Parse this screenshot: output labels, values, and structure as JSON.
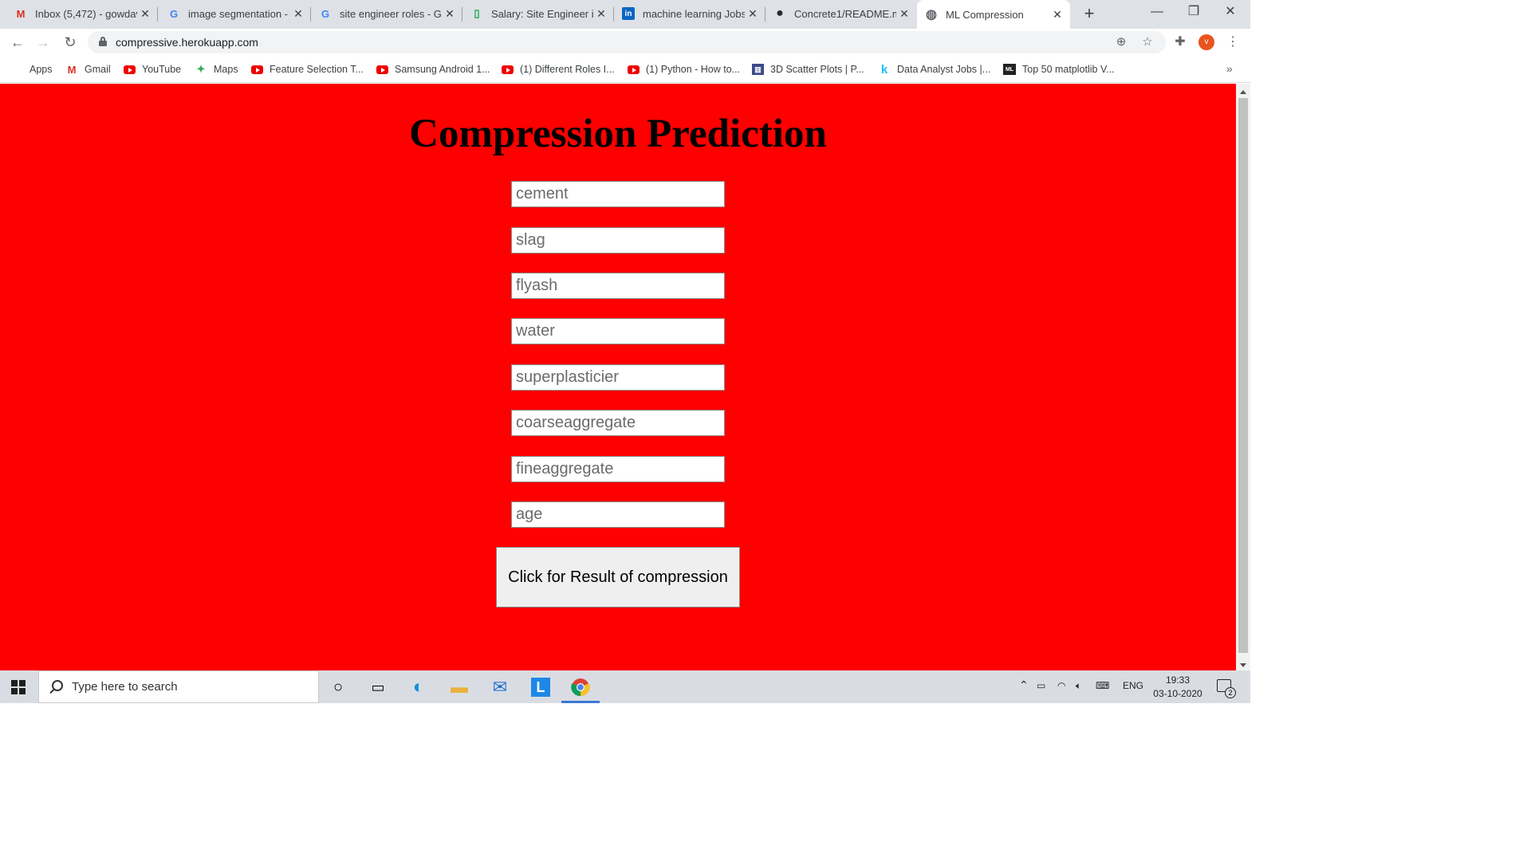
{
  "browser": {
    "tabs": [
      {
        "title": "Inbox (5,472) - gowdav",
        "icon": "gmail-icon",
        "fav": "M",
        "fav_color": "#d93025"
      },
      {
        "title": "image segmentation - C",
        "icon": "google-icon",
        "fav": "G",
        "fav_color": "#4285f4"
      },
      {
        "title": "site engineer roles - Go",
        "icon": "google-icon",
        "fav": "G",
        "fav_color": "#4285f4"
      },
      {
        "title": "Salary: Site Engineer in",
        "icon": "glassdoor-icon",
        "fav": "▯",
        "fav_color": "#0caa41"
      },
      {
        "title": "machine learning Jobs",
        "icon": "linkedin-icon",
        "fav": "in",
        "fav_color": "#0a66c2"
      },
      {
        "title": "Concrete1/README.md",
        "icon": "github-icon",
        "fav": "●",
        "fav_color": "#24292e"
      },
      {
        "title": "ML Compression",
        "icon": "globe-icon",
        "fav": "◍",
        "fav_color": "#5f6368"
      }
    ],
    "new_tab": "+",
    "window_controls": {
      "minimize": "—",
      "restore": "❐",
      "close": "✕"
    },
    "url": "compressive.herokuapp.com",
    "profile_initial": "v"
  },
  "bookmarks": [
    {
      "label": "Apps",
      "icon": "apps-grid-icon"
    },
    {
      "label": "Gmail",
      "icon": "gmail-icon"
    },
    {
      "label": "YouTube",
      "icon": "youtube-icon"
    },
    {
      "label": "Maps",
      "icon": "maps-icon"
    },
    {
      "label": "Feature Selection T...",
      "icon": "youtube-icon"
    },
    {
      "label": "Samsung Android 1...",
      "icon": "youtube-icon"
    },
    {
      "label": "(1) Different Roles I...",
      "icon": "youtube-icon"
    },
    {
      "label": "(1) Python - How to...",
      "icon": "youtube-icon"
    },
    {
      "label": "3D Scatter Plots | P...",
      "icon": "plotly-icon"
    },
    {
      "label": "Data Analyst Jobs |...",
      "icon": "kaggle-icon"
    },
    {
      "label": "Top 50 matplotlib V...",
      "icon": "ml-icon"
    }
  ],
  "page": {
    "title": "Compression Prediction",
    "fields": [
      {
        "name": "cement",
        "placeholder": "cement"
      },
      {
        "name": "slag",
        "placeholder": "slag"
      },
      {
        "name": "flyash",
        "placeholder": "flyash"
      },
      {
        "name": "water",
        "placeholder": "water"
      },
      {
        "name": "superplasticier",
        "placeholder": "superplasticier"
      },
      {
        "name": "coarseaggregate",
        "placeholder": "coarseaggregate"
      },
      {
        "name": "fineaggregate",
        "placeholder": "fineaggregate"
      },
      {
        "name": "age",
        "placeholder": "age"
      }
    ],
    "submit_label": "Click for Result of compression",
    "background_color": "#ff0000"
  },
  "taskbar": {
    "search_placeholder": "Type here to search",
    "language": "ENG",
    "time": "19:33",
    "date": "03-10-2020",
    "notification_count": "2"
  }
}
